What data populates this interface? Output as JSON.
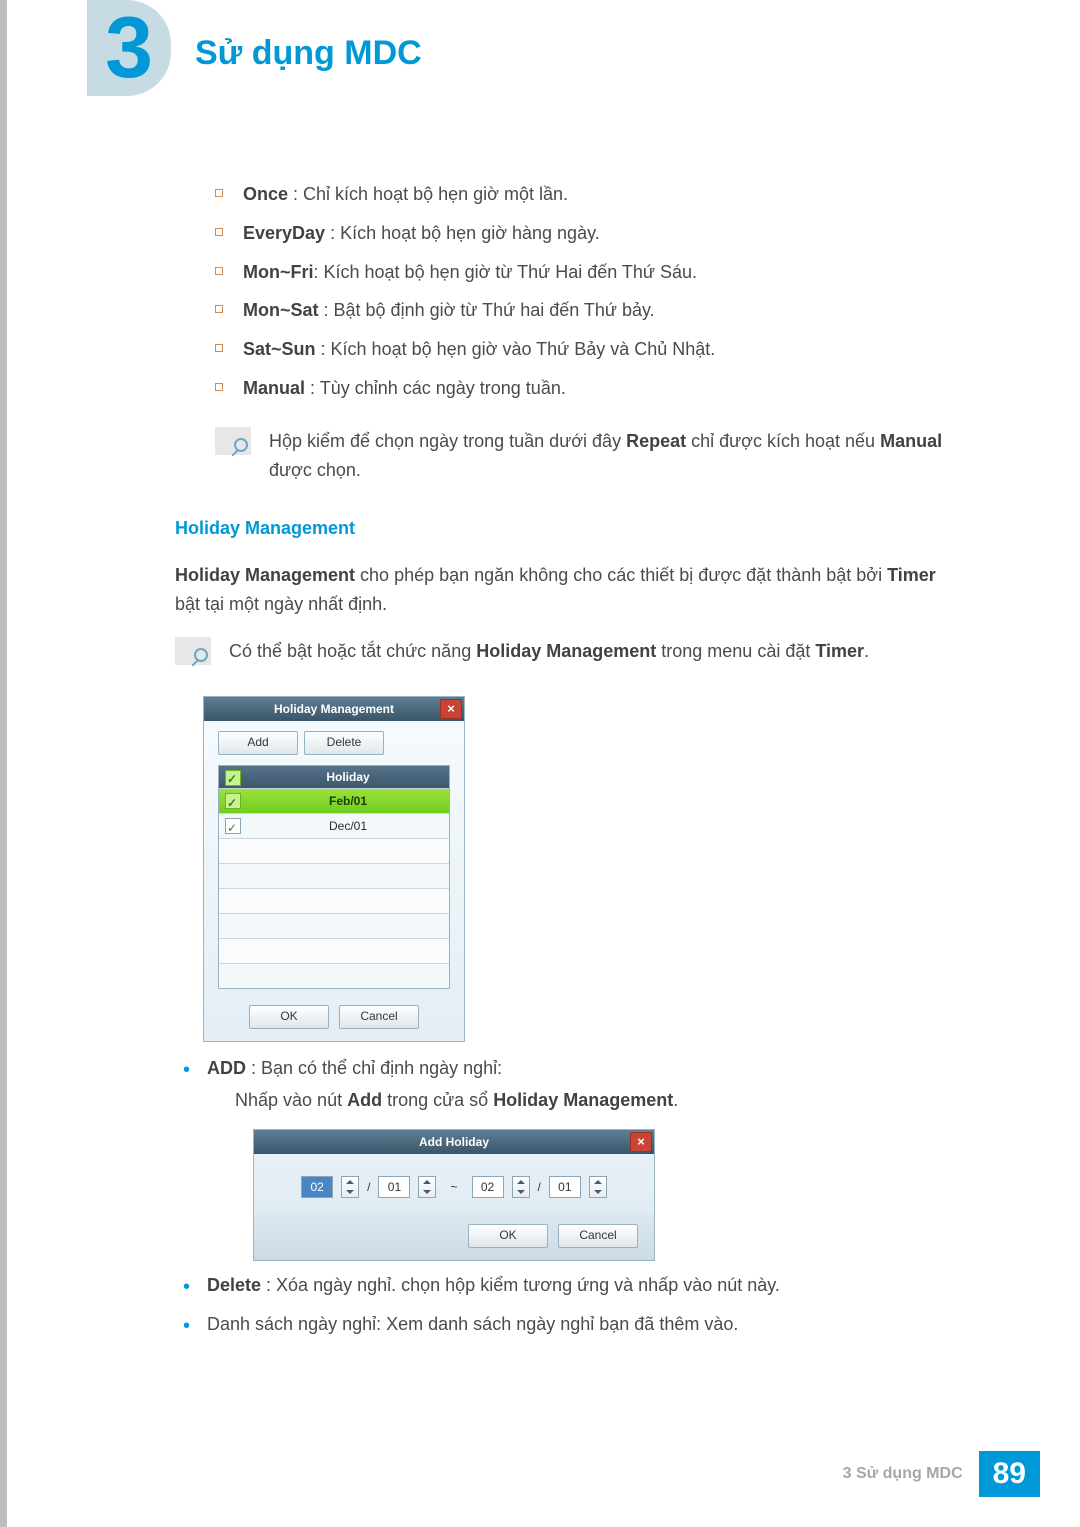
{
  "chapter": {
    "number": "3",
    "title": "Sử dụng MDC"
  },
  "repeat_items": [
    {
      "label": "Once",
      "desc": " : Chỉ kích hoạt bộ hẹn giờ một lần."
    },
    {
      "label": "EveryDay",
      "desc": " : Kích hoạt bộ hẹn giờ hàng ngày."
    },
    {
      "label": "Mon~Fri",
      "desc": ": Kích hoạt bộ hẹn giờ từ Thứ Hai đến Thứ Sáu."
    },
    {
      "label": "Mon~Sat",
      "desc": " : Bật bộ định giờ từ Thứ hai đến Thứ bảy."
    },
    {
      "label": "Sat~Sun",
      "desc": " : Kích hoạt bộ hẹn giờ vào Thứ Bảy và Chủ Nhật."
    },
    {
      "label": "Manual",
      "desc": " : Tùy chỉnh các ngày trong tuần."
    }
  ],
  "note1": {
    "pre": "Hộp kiểm để chọn ngày trong tuần dưới đây ",
    "b1": "Repeat",
    "mid": " chỉ được kích hoạt nếu ",
    "b2": "Manual",
    "post": " được chọn."
  },
  "holiday": {
    "heading": "Holiday Management",
    "para_pre": "Holiday Management",
    "para_mid": " cho phép bạn ngăn không cho các thiết bị được đặt thành bật bởi ",
    "para_b2": "Timer",
    "para_post": " bật tại một ngày nhất định."
  },
  "note2": {
    "pre": "Có thể bật hoặc tắt chức năng ",
    "b1": "Holiday Management",
    "mid": " trong menu cài đặt ",
    "b2": "Timer",
    "post": "."
  },
  "dialog1": {
    "title": "Holiday Management",
    "add": "Add",
    "delete": "Delete",
    "col_holiday": "Holiday",
    "rows": [
      "Feb/01",
      "Dec/01"
    ],
    "ok": "OK",
    "cancel": "Cancel"
  },
  "bullets": {
    "add_label": "ADD",
    "add_desc": " : Bạn có thể chỉ định ngày nghỉ:",
    "add_sub_pre": "Nhấp vào nút ",
    "add_sub_b1": "Add",
    "add_sub_mid": " trong cửa sổ ",
    "add_sub_b2": "Holiday Management",
    "add_sub_post": ".",
    "del_label": "Delete",
    "del_desc": " : Xóa ngày nghỉ. chọn hộp kiểm tương ứng và nhấp vào nút này.",
    "list_desc": "Danh sách ngày nghỉ: Xem danh sách ngày nghỉ bạn đã thêm vào."
  },
  "dialog2": {
    "title": "Add Holiday",
    "fields": {
      "m1": "02",
      "d1": "01",
      "m2": "02",
      "d2": "01"
    },
    "slash": "/",
    "tilde": "~",
    "ok": "OK",
    "cancel": "Cancel"
  },
  "footer": {
    "text": "3 Sử dụng MDC",
    "page": "89"
  }
}
